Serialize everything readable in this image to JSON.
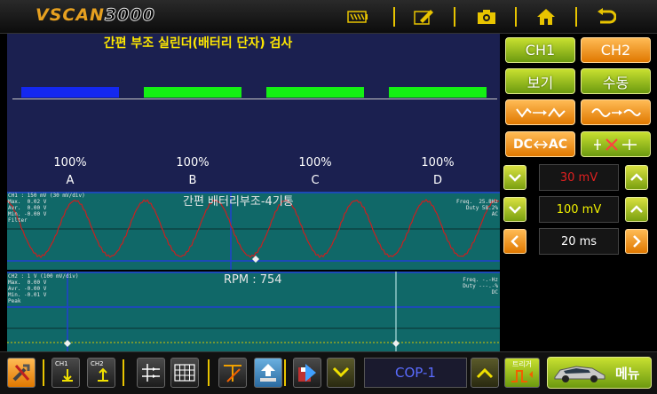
{
  "app": {
    "logo_brand": "VSCAN",
    "logo_model": "3000"
  },
  "topbar": {
    "icons": [
      "battery-icon",
      "edit-icon",
      "camera-icon",
      "home-icon",
      "back-icon"
    ]
  },
  "cylinder_test": {
    "title": "간편 부조 실린더(배터리 단자) 검사",
    "cylinders": [
      {
        "label": "A",
        "percent": "100%",
        "color": "#1428f0"
      },
      {
        "label": "B",
        "percent": "100%",
        "color": "#14f014"
      },
      {
        "label": "C",
        "percent": "100%",
        "color": "#14f014"
      },
      {
        "label": "D",
        "percent": "100%",
        "color": "#14f014"
      }
    ]
  },
  "ch1_panel": {
    "info": "CH1 : 150 mV (30 mV/div)\nMax.  0.02 V\nAvr.  0.00 V\nMin. -0.00 V\nFilter",
    "title": "간편 배터리부조-4기통",
    "freq": "Freq.  25.8Hz\nDuty 58.2%\nAC",
    "trace_color": "#c82020"
  },
  "ch2_panel": {
    "info": "CH2 : 1 V (100 mV/div)\nMax.  0.00 V\nAvr. -0.00 V\nMin. -0.01 V\nPeak",
    "rpm_label": "RPM : 754",
    "freq": "Freq. -.-Hz\nDuty ---.-%\nDC"
  },
  "right_panel": {
    "ch1": "CH1",
    "ch2": "CH2",
    "view": "보기",
    "manual": "수동",
    "volt_ch1": "30 mV",
    "volt_ch2": "100 mV",
    "time": "20 ms",
    "dc_ac_label_dc": "DC",
    "dc_ac_label_ac": "AC"
  },
  "bottom": {
    "ch1_label": "CH1",
    "ch2_label": "CH2",
    "cop_value": "COP-1",
    "trigger_label": "트리거",
    "menu_label": "메뉴"
  },
  "colors": {
    "accent_yellow": "#e8c400",
    "button_green": "#9ac020",
    "button_orange": "#f08a10",
    "trace_bg": "#106868"
  }
}
